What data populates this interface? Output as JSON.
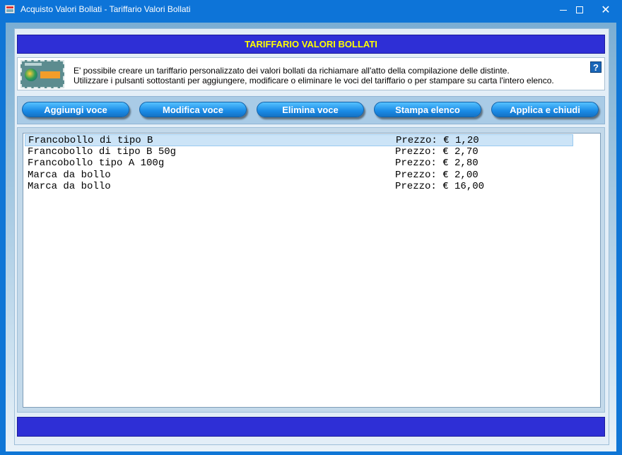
{
  "window": {
    "title": "Acquisto Valori Bollati - Tariffario Valori Bollati",
    "close_glyph": "✕"
  },
  "header": {
    "title": "TARIFFARIO VALORI BOLLATI"
  },
  "info": {
    "line1": "E' possibile creare un tariffario personalizzato dei valori bollati da richiamare all'atto della compilazione delle distinte.",
    "line2": "Utilizzare i pulsanti sottostanti per aggiungere, modificare o eliminare le voci del tariffario o per stampare su carta l'intero elenco.",
    "help_label": "?"
  },
  "toolbar": {
    "add_label": "Aggiungi voce",
    "edit_label": "Modifica voce",
    "delete_label": "Elimina voce",
    "print_label": "Stampa elenco",
    "apply_label": "Applica e chiudi"
  },
  "list": {
    "selected_index": 0,
    "items": [
      {
        "name": "Francobollo di tipo B",
        "price": "Prezzo: € 1,20"
      },
      {
        "name": "Francobollo di tipo B 50g",
        "price": "Prezzo: € 2,70"
      },
      {
        "name": "Francobollo tipo A 100g",
        "price": "Prezzo: € 2,80"
      },
      {
        "name": "Marca da bollo",
        "price": "Prezzo: € 2,00"
      },
      {
        "name": "Marca da bollo",
        "price": "Prezzo: € 16,00"
      }
    ]
  },
  "icons": {
    "app": "stamp-app-icon",
    "help": "help-icon",
    "stamp": "stamp-image"
  },
  "colors": {
    "header_bg": "#2e2fd6",
    "header_text": "#ffff00",
    "button_bg": "#1a8be6",
    "selection_bg": "#cce4f7"
  }
}
